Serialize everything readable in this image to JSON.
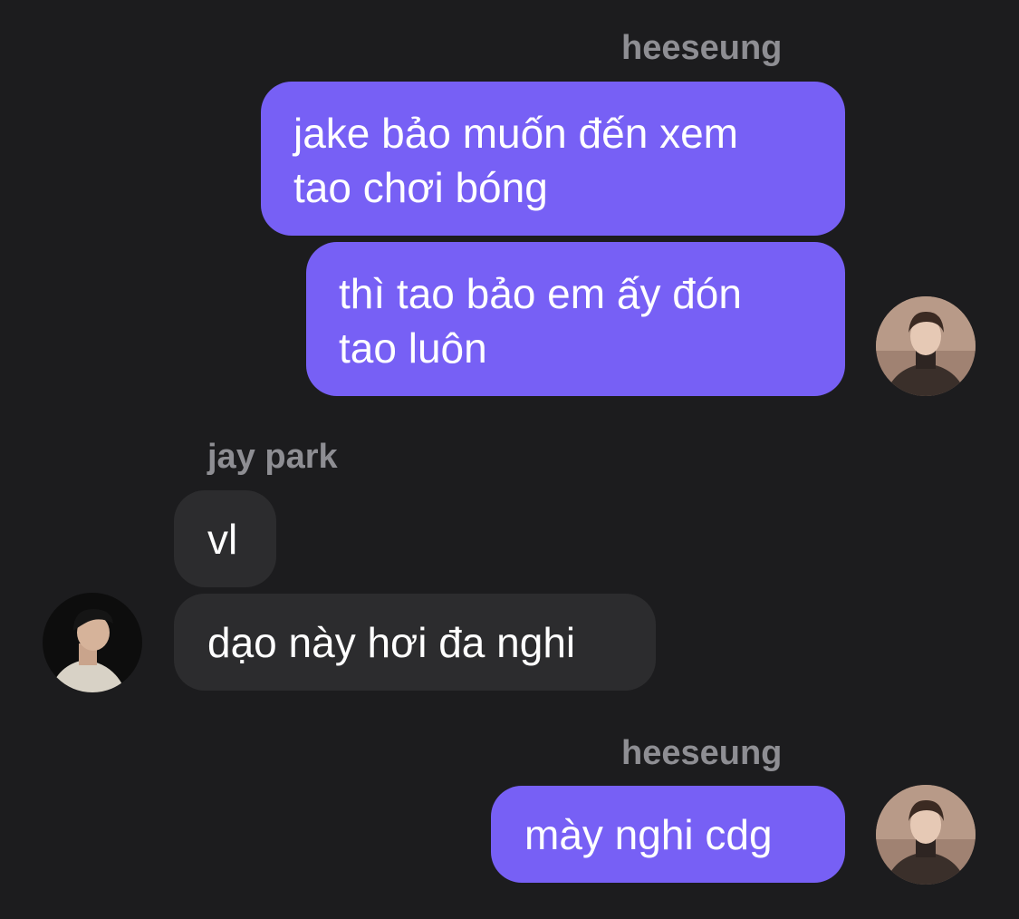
{
  "conversation": {
    "groups": [
      {
        "sender": "heeseung",
        "messages": [
          "jake bảo muốn đến xem\ntao chơi bóng",
          "thì tao bảo em ấy đón\ntao luôn"
        ]
      },
      {
        "sender": "jay park",
        "messages": [
          "vl",
          "dạo này hơi đa nghi"
        ]
      },
      {
        "sender": "heeseung",
        "messages": [
          "mày nghi cdg"
        ]
      }
    ]
  },
  "colors": {
    "background": "#1c1c1e",
    "outgoing_bubble": "#7760f5",
    "incoming_bubble": "#2c2c2e",
    "sender_name": "#8e8e93",
    "message_text": "#ffffff"
  }
}
